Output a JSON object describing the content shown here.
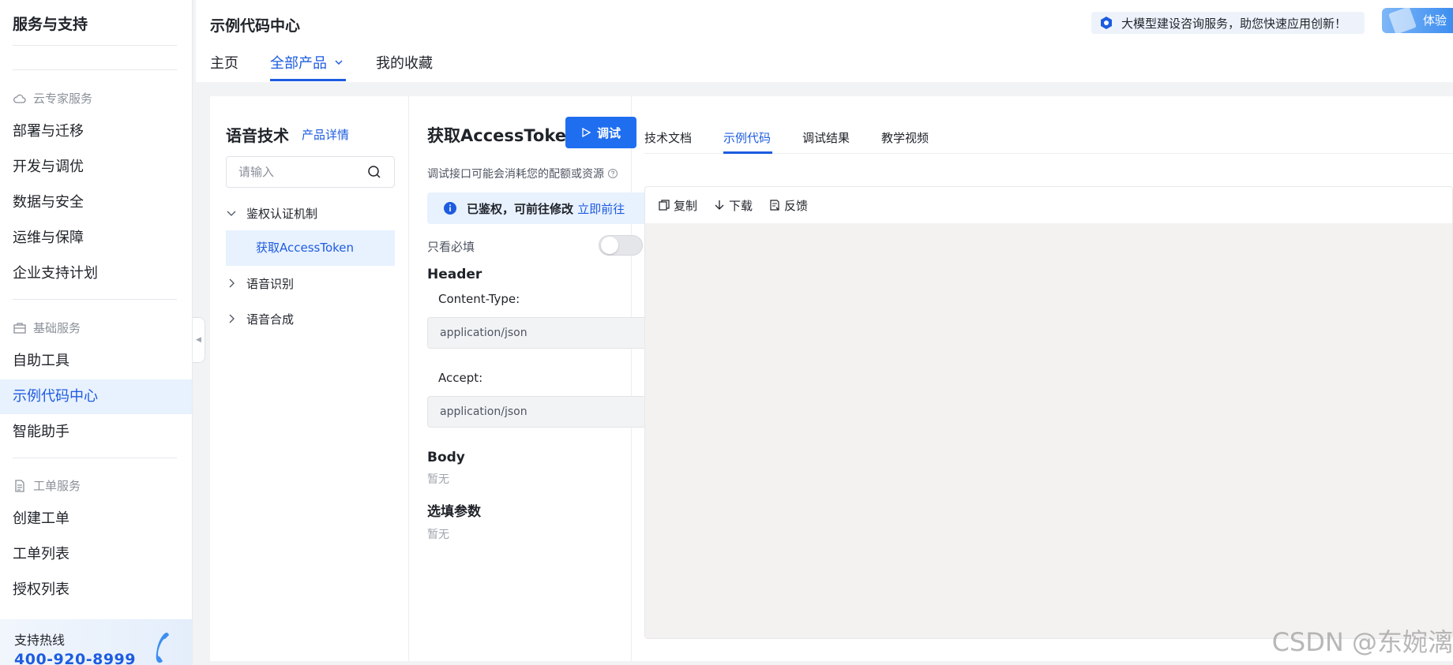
{
  "sidebar": {
    "title": "服务与支持",
    "groups": {
      "cloud_expert": "云专家服务",
      "basic": "基础服务",
      "ticket": "工单服务"
    },
    "items": {
      "deploy": "部署与迁移",
      "dev": "开发与调优",
      "data": "数据与安全",
      "ops": "运维与保障",
      "enterprise": "企业支持计划",
      "selfhelp": "自助工具",
      "sample": "示例代码中心",
      "assistant": "智能助手",
      "create_ticket": "创建工单",
      "ticket_list": "工单列表",
      "auth_list": "授权列表"
    },
    "hotline_label": "支持热线",
    "hotline_number": "400-920-8999"
  },
  "header": {
    "title": "示例代码中心",
    "notice": "大模型建设咨询服务，助您快速应用创新！",
    "try_label": "体验",
    "tabs": [
      "主页",
      "全部产品",
      "我的收藏"
    ]
  },
  "product": {
    "title": "语音技术",
    "detail_link": "产品详情",
    "search_placeholder": "请输入",
    "tree": {
      "auth": "鉴权认证机制",
      "get_token": "获取AccessToken",
      "asr": "语音识别",
      "tts": "语音合成"
    }
  },
  "api": {
    "title": "获取AccessToken",
    "debug_label": "调试",
    "hint": "调试接口可能会消耗您的配额或资源",
    "auth_text": "已鉴权，可前往修改",
    "auth_link": "立即前往",
    "only_required": "只看必填",
    "only_required_on": false,
    "header_title": "Header",
    "content_type_label": "Content-Type:",
    "content_type_value": "application/json",
    "accept_label": "Accept:",
    "accept_value": "application/json",
    "body_title": "Body",
    "body_empty": "暂无",
    "optional_title": "选填参数",
    "optional_empty": "暂无"
  },
  "code": {
    "tabs": [
      "技术文档",
      "示例代码",
      "调试结果",
      "教学视频"
    ],
    "active_tab": "示例代码",
    "toolbar": {
      "copy": "复制",
      "download": "下载",
      "feedback": "反馈"
    }
  },
  "watermark": "CSDN @东婉漓",
  "colors": {
    "accent": "#1d5ce0",
    "active_bg": "#e8f1fe",
    "code_bg": "#f4f2f0"
  }
}
